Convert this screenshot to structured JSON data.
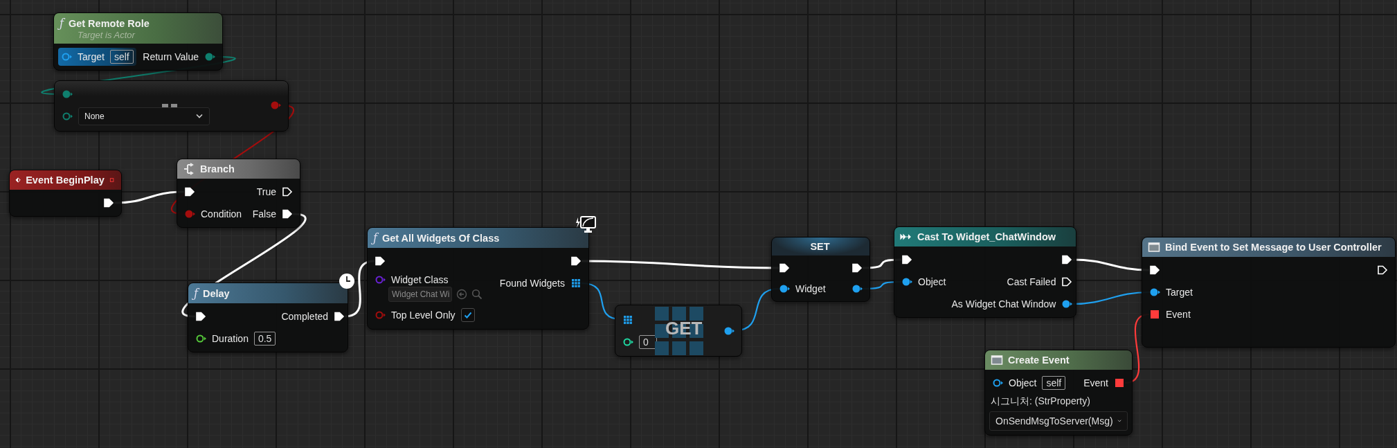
{
  "graph": {
    "nodes": [
      {
        "kind": "pure_function",
        "glyph": "ƒ",
        "title": "Get Remote Role",
        "subtitle": "Target is Actor",
        "inputs": [
          {
            "kind": "object",
            "label": "Target",
            "value": "self",
            "connected": false,
            "hovered": true
          }
        ],
        "outputs": [
          {
            "kind": "enum",
            "label": "Return Value",
            "connected": true,
            "hovered": false
          }
        ]
      },
      {
        "kind": "operator",
        "inputs": [
          {
            "kind": "enum",
            "connected": true
          },
          {
            "kind": "enum",
            "choice": "None",
            "connected": false
          }
        ],
        "outputs": [
          {
            "kind": "bool",
            "connected": true
          }
        ]
      },
      {
        "kind": "event",
        "title": "Event BeginPlay",
        "header_pin": {
          "kind": "delegate",
          "connected": false
        },
        "outputs": [
          {
            "kind": "exec",
            "connected": true
          }
        ]
      },
      {
        "kind": "branch",
        "title": "Branch",
        "inputs": [
          {
            "kind": "exec",
            "connected": true
          },
          {
            "kind": "bool",
            "label": "Condition",
            "connected": true
          }
        ],
        "outputs": [
          {
            "kind": "exec",
            "label": "True",
            "connected": false
          },
          {
            "kind": "exec",
            "label": "False",
            "connected": true
          }
        ]
      },
      {
        "kind": "function",
        "glyph": "ƒ",
        "title": "Delay",
        "latent": true,
        "inputs": [
          {
            "kind": "exec",
            "connected": true
          },
          {
            "kind": "float",
            "label": "Duration",
            "value": "0.5",
            "connected": false
          }
        ],
        "outputs": [
          {
            "kind": "exec",
            "label": "Completed",
            "connected": true
          }
        ]
      },
      {
        "kind": "function",
        "glyph": "ƒ",
        "title": "Get All Widgets Of Class",
        "client_only": true,
        "inputs": [
          {
            "kind": "exec",
            "connected": true
          },
          {
            "kind": "class",
            "label": "Widget Class",
            "choice": "Widget Chat Wi",
            "connected": false
          },
          {
            "kind": "bool",
            "label": "Top Level Only",
            "checked": true,
            "connected": false
          }
        ],
        "outputs": [
          {
            "kind": "exec",
            "connected": true
          },
          {
            "kind": "array",
            "label": "Found Widgets",
            "connected": true
          }
        ]
      },
      {
        "kind": "array_get",
        "title": "GET",
        "inputs": [
          {
            "kind": "array",
            "connected": true
          },
          {
            "kind": "int",
            "value": "0",
            "connected": false
          }
        ],
        "outputs": [
          {
            "kind": "object",
            "connected": true
          }
        ]
      },
      {
        "kind": "set",
        "title": "SET",
        "inputs": [
          {
            "kind": "exec",
            "connected": true
          },
          {
            "kind": "object",
            "label": "Widget",
            "connected": true
          }
        ],
        "outputs": [
          {
            "kind": "exec",
            "connected": true
          },
          {
            "kind": "object",
            "connected": true
          }
        ]
      },
      {
        "kind": "cast",
        "title": "Cast To Widget_ChatWindow",
        "inputs": [
          {
            "kind": "exec",
            "connected": true
          },
          {
            "kind": "object",
            "label": "Object",
            "connected": true
          }
        ],
        "outputs": [
          {
            "kind": "exec",
            "connected": true
          },
          {
            "kind": "exec",
            "label": "Cast Failed",
            "connected": false
          },
          {
            "kind": "object",
            "label": "As Widget Chat Window",
            "connected": true
          }
        ]
      },
      {
        "kind": "bind",
        "title": "Bind Event to Set Message to User Controller",
        "inputs": [
          {
            "kind": "exec",
            "connected": true
          },
          {
            "kind": "object",
            "label": "Target",
            "connected": true
          },
          {
            "kind": "delegate",
            "label": "Event",
            "connected": true
          }
        ],
        "outputs": [
          {
            "kind": "exec",
            "connected": false
          }
        ]
      },
      {
        "kind": "create_event",
        "title": "Create Event",
        "inputs": [
          {
            "kind": "object",
            "label": "Object",
            "value": "self",
            "connected": false
          }
        ],
        "outputs": [
          {
            "kind": "delegate",
            "label": "Event",
            "connected": true
          }
        ],
        "signature": "시그니처: (StrProperty)",
        "function_choice": "OnSendMsgToServer(Msg)"
      }
    ]
  }
}
